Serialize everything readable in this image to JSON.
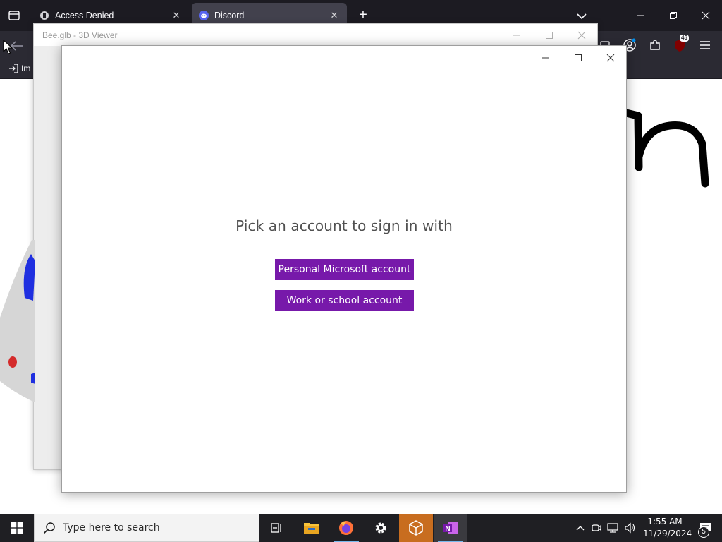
{
  "browser": {
    "tabs": [
      {
        "title": "Access Denied",
        "icon": "shield-badge-icon",
        "active": false
      },
      {
        "title": "Discord",
        "icon": "discord-icon",
        "active": true
      }
    ],
    "extension_badge": "46",
    "bookmarks": {
      "import_label": "Im"
    }
  },
  "viewer_window": {
    "title": "Bee.glb - 3D Viewer"
  },
  "signin_dialog": {
    "heading": "Pick an account to sign in with",
    "buttons": {
      "personal": "Personal Microsoft account",
      "work": "Work or school account"
    },
    "button_color": "#7719aa"
  },
  "taskbar": {
    "search_placeholder": "Type here to search",
    "apps": [
      "task-view-icon",
      "file-explorer-icon",
      "firefox-icon",
      "settings-gear-icon",
      "3d-viewer-icon",
      "onenote-icon"
    ],
    "clock": {
      "time": "1:55 AM",
      "date": "11/29/2024"
    },
    "notification_count": "5"
  }
}
